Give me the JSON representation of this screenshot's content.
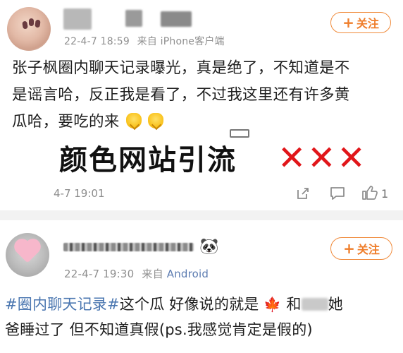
{
  "post1": {
    "timestamp": "22-4-7 18:59",
    "source_prefix": "来自",
    "source": "iPhone客户端",
    "follow_label": "关注",
    "body_lines": [
      "张子枫圈内聊天记录曝光，真是绝了，不知道是不",
      "是谣言哈，反正我是看了，不过我这里还有许多黄",
      "瓜哈，要吃的来"
    ],
    "overlay_title": "颜色网站引流",
    "overlay_marks": "✕✕✕",
    "footer_time": "4-7 19:01",
    "like_count": "1",
    "icons": [
      "avatar",
      "plus-icon",
      "finger-down-icon",
      "share-icon",
      "comment-icon",
      "like-icon"
    ]
  },
  "post2": {
    "timestamp": "22-4-7 19:30",
    "source_prefix": "来自",
    "source": "Android",
    "follow_label": "关注",
    "hashtag": "#圈内聊天记录#",
    "body_part1": "这个瓜 好像说的就是",
    "body_part2": "和",
    "body_part3": "她",
    "body_line2": "爸睡过了 但不知道真假(ps.我感觉肯定是假的)",
    "icons": [
      "avatar",
      "panda-icon",
      "plus-icon",
      "maple-leaf-icon"
    ]
  },
  "colors": {
    "accent_orange": "#ef7d2a",
    "link_blue": "#4a76b0",
    "cross_red": "#e1161a"
  }
}
